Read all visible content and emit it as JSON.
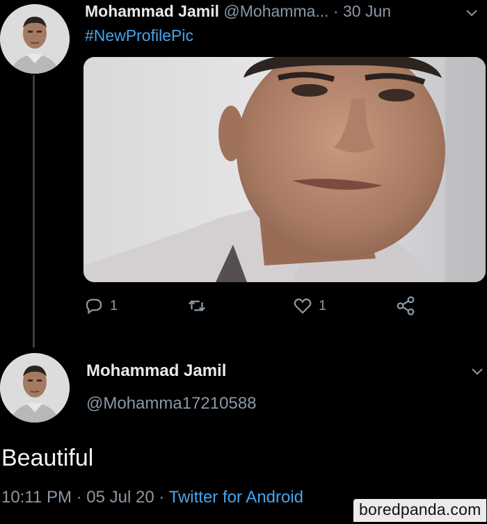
{
  "tweet": {
    "author_name": "Mohammad Jamil",
    "handle_truncated": "@Mohamma...",
    "separator": "·",
    "date": "30 Jun",
    "text": "#NewProfilePic",
    "actions": {
      "reply_count": "1",
      "like_count": "1"
    }
  },
  "reply": {
    "author_name": "Mohammad Jamil",
    "handle": "@Mohamma17210588",
    "text": "Beautiful",
    "time": "10:11 PM",
    "separator": "·",
    "date": "05 Jul 20",
    "separator2": "·",
    "source": "Twitter for Android"
  },
  "watermark": "boredpanda.com",
  "icons": {
    "reply": "reply-icon",
    "retweet": "retweet-icon",
    "like": "heart-icon",
    "share": "share-icon",
    "more": "chevron-down-icon"
  },
  "colors": {
    "background": "#000000",
    "text": "#e7e9ea",
    "muted": "#8b98a5",
    "link": "#4aa3ea"
  }
}
